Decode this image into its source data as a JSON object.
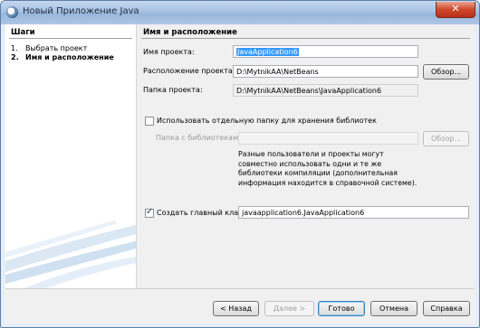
{
  "window": {
    "title": "Новый Приложение Java",
    "close_label": "✕"
  },
  "steps": {
    "header": "Шаги",
    "items": [
      {
        "num": "1.",
        "label": "Выбрать проект"
      },
      {
        "num": "2.",
        "label": "Имя и расположение"
      }
    ]
  },
  "main": {
    "header": "Имя и расположение",
    "project_name_label": "Имя проекта:",
    "project_name_value": "JavaApplication6",
    "project_location_label": "Расположение проекта:",
    "project_location_value": "D:\\MytnikAA\\NetBeans",
    "browse_label": "Обзор...",
    "project_folder_label": "Папка проекта:",
    "project_folder_value": "D:\\MytnikAA\\NetBeans\\JavaApplication6",
    "use_lib_folder_label": "Использовать отдельную папку для хранения библиотек",
    "lib_folder_label": "Папка с библиотеками:",
    "lib_folder_value": "",
    "lib_browse_label": "Обзор...",
    "lib_note": "Разные пользователи и проекты могут совместно использовать одни и те же библиотеки компиляции (дополнительная информация находится в справочной системе).",
    "create_main_class_label": "Создать главный класс",
    "main_class_value": "javaapplication6.JavaApplication6",
    "create_main_class_checked": true,
    "use_lib_folder_checked": false
  },
  "footer": {
    "back_label": "< Назад",
    "next_label": "Далее >",
    "finish_label": "Готово",
    "cancel_label": "Отмена",
    "help_label": "Справка"
  }
}
